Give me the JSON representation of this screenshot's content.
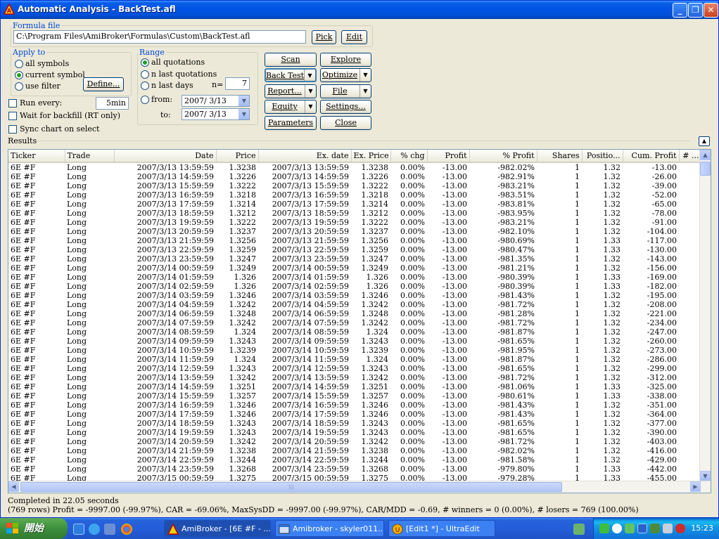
{
  "window": {
    "title": "Automatic Analysis - BackTest.afl"
  },
  "formula": {
    "legend": "Formula file",
    "path": "C:\\Program Files\\AmiBroker\\Formulas\\Custom\\BackTest.afl",
    "pick": "Pick",
    "edit": "Edit"
  },
  "apply_to": {
    "legend": "Apply to",
    "all_symbols": "all symbols",
    "current_symbol": "current symbol",
    "use_filter": "use filter",
    "define": "Define...",
    "selected": "current symbol"
  },
  "range": {
    "legend": "Range",
    "all_quotations": "all quotations",
    "n_last_quotations": "n last quotations",
    "n_last_days": "n last days",
    "n_label": "n=",
    "n_value": "7",
    "from_label": "from:",
    "to_label": "to:",
    "from_date": "2007/  3/13",
    "to_date": "2007/  3/13",
    "selected": "all quotations"
  },
  "options": {
    "run_every": "Run every:",
    "run_every_value": "5min",
    "wait_backfill": "Wait for backfill (RT only)",
    "sync_chart": "Sync chart on select"
  },
  "buttons": {
    "scan": "Scan",
    "explore": "Explore",
    "back_test": "Back Test",
    "optimize": "Optimize",
    "report": "Report...",
    "file": "File",
    "equity": "Equity",
    "settings": "Settings...",
    "parameters": "Parameters",
    "close": "Close"
  },
  "results": {
    "label": "Results",
    "columns": [
      "Ticker",
      "Trade",
      "Date",
      "Price",
      "Ex. date",
      "Ex. Price",
      "% chg",
      "Profit",
      "% Profit",
      "Shares",
      "Positio...",
      "Cum. Profit",
      "# ..."
    ],
    "rows": [
      [
        "6E #F",
        "Long",
        "2007/3/13 13:59:59",
        "1.3238",
        "2007/3/13 13:59:59",
        "1.3238",
        "0.00%",
        "-13.00",
        "-982.02%",
        "1",
        "1.32",
        "-13.00"
      ],
      [
        "6E #F",
        "Long",
        "2007/3/13 14:59:59",
        "1.3226",
        "2007/3/13 14:59:59",
        "1.3226",
        "0.00%",
        "-13.00",
        "-982.91%",
        "1",
        "1.32",
        "-26.00"
      ],
      [
        "6E #F",
        "Long",
        "2007/3/13 15:59:59",
        "1.3222",
        "2007/3/13 15:59:59",
        "1.3222",
        "0.00%",
        "-13.00",
        "-983.21%",
        "1",
        "1.32",
        "-39.00"
      ],
      [
        "6E #F",
        "Long",
        "2007/3/13 16:59:59",
        "1.3218",
        "2007/3/13 16:59:59",
        "1.3218",
        "0.00%",
        "-13.00",
        "-983.51%",
        "1",
        "1.32",
        "-52.00"
      ],
      [
        "6E #F",
        "Long",
        "2007/3/13 17:59:59",
        "1.3214",
        "2007/3/13 17:59:59",
        "1.3214",
        "0.00%",
        "-13.00",
        "-983.81%",
        "1",
        "1.32",
        "-65.00"
      ],
      [
        "6E #F",
        "Long",
        "2007/3/13 18:59:59",
        "1.3212",
        "2007/3/13 18:59:59",
        "1.3212",
        "0.00%",
        "-13.00",
        "-983.95%",
        "1",
        "1.32",
        "-78.00"
      ],
      [
        "6E #F",
        "Long",
        "2007/3/13 19:59:59",
        "1.3222",
        "2007/3/13 19:59:59",
        "1.3222",
        "0.00%",
        "-13.00",
        "-983.21%",
        "1",
        "1.32",
        "-91.00"
      ],
      [
        "6E #F",
        "Long",
        "2007/3/13 20:59:59",
        "1.3237",
        "2007/3/13 20:59:59",
        "1.3237",
        "0.00%",
        "-13.00",
        "-982.10%",
        "1",
        "1.32",
        "-104.00"
      ],
      [
        "6E #F",
        "Long",
        "2007/3/13 21:59:59",
        "1.3256",
        "2007/3/13 21:59:59",
        "1.3256",
        "0.00%",
        "-13.00",
        "-980.69%",
        "1",
        "1.33",
        "-117.00"
      ],
      [
        "6E #F",
        "Long",
        "2007/3/13 22:59:59",
        "1.3259",
        "2007/3/13 22:59:59",
        "1.3259",
        "0.00%",
        "-13.00",
        "-980.47%",
        "1",
        "1.33",
        "-130.00"
      ],
      [
        "6E #F",
        "Long",
        "2007/3/13 23:59:59",
        "1.3247",
        "2007/3/13 23:59:59",
        "1.3247",
        "0.00%",
        "-13.00",
        "-981.35%",
        "1",
        "1.32",
        "-143.00"
      ],
      [
        "6E #F",
        "Long",
        "2007/3/14 00:59:59",
        "1.3249",
        "2007/3/14 00:59:59",
        "1.3249",
        "0.00%",
        "-13.00",
        "-981.21%",
        "1",
        "1.32",
        "-156.00"
      ],
      [
        "6E #F",
        "Long",
        "2007/3/14 01:59:59",
        "1.326",
        "2007/3/14 01:59:59",
        "1.326",
        "0.00%",
        "-13.00",
        "-980.39%",
        "1",
        "1.33",
        "-169.00"
      ],
      [
        "6E #F",
        "Long",
        "2007/3/14 02:59:59",
        "1.326",
        "2007/3/14 02:59:59",
        "1.326",
        "0.00%",
        "-13.00",
        "-980.39%",
        "1",
        "1.33",
        "-182.00"
      ],
      [
        "6E #F",
        "Long",
        "2007/3/14 03:59:59",
        "1.3246",
        "2007/3/14 03:59:59",
        "1.3246",
        "0.00%",
        "-13.00",
        "-981.43%",
        "1",
        "1.32",
        "-195.00"
      ],
      [
        "6E #F",
        "Long",
        "2007/3/14 04:59:59",
        "1.3242",
        "2007/3/14 04:59:59",
        "1.3242",
        "0.00%",
        "-13.00",
        "-981.72%",
        "1",
        "1.32",
        "-208.00"
      ],
      [
        "6E #F",
        "Long",
        "2007/3/14 06:59:59",
        "1.3248",
        "2007/3/14 06:59:59",
        "1.3248",
        "0.00%",
        "-13.00",
        "-981.28%",
        "1",
        "1.32",
        "-221.00"
      ],
      [
        "6E #F",
        "Long",
        "2007/3/14 07:59:59",
        "1.3242",
        "2007/3/14 07:59:59",
        "1.3242",
        "0.00%",
        "-13.00",
        "-981.72%",
        "1",
        "1.32",
        "-234.00"
      ],
      [
        "6E #F",
        "Long",
        "2007/3/14 08:59:59",
        "1.324",
        "2007/3/14 08:59:59",
        "1.324",
        "0.00%",
        "-13.00",
        "-981.87%",
        "1",
        "1.32",
        "-247.00"
      ],
      [
        "6E #F",
        "Long",
        "2007/3/14 09:59:59",
        "1.3243",
        "2007/3/14 09:59:59",
        "1.3243",
        "0.00%",
        "-13.00",
        "-981.65%",
        "1",
        "1.32",
        "-260.00"
      ],
      [
        "6E #F",
        "Long",
        "2007/3/14 10:59:59",
        "1.3239",
        "2007/3/14 10:59:59",
        "1.3239",
        "0.00%",
        "-13.00",
        "-981.95%",
        "1",
        "1.32",
        "-273.00"
      ],
      [
        "6E #F",
        "Long",
        "2007/3/14 11:59:59",
        "1.324",
        "2007/3/14 11:59:59",
        "1.324",
        "0.00%",
        "-13.00",
        "-981.87%",
        "1",
        "1.32",
        "-286.00"
      ],
      [
        "6E #F",
        "Long",
        "2007/3/14 12:59:59",
        "1.3243",
        "2007/3/14 12:59:59",
        "1.3243",
        "0.00%",
        "-13.00",
        "-981.65%",
        "1",
        "1.32",
        "-299.00"
      ],
      [
        "6E #F",
        "Long",
        "2007/3/14 13:59:59",
        "1.3242",
        "2007/3/14 13:59:59",
        "1.3242",
        "0.00%",
        "-13.00",
        "-981.72%",
        "1",
        "1.32",
        "-312.00"
      ],
      [
        "6E #F",
        "Long",
        "2007/3/14 14:59:59",
        "1.3251",
        "2007/3/14 14:59:59",
        "1.3251",
        "0.00%",
        "-13.00",
        "-981.06%",
        "1",
        "1.33",
        "-325.00"
      ],
      [
        "6E #F",
        "Long",
        "2007/3/14 15:59:59",
        "1.3257",
        "2007/3/14 15:59:59",
        "1.3257",
        "0.00%",
        "-13.00",
        "-980.61%",
        "1",
        "1.33",
        "-338.00"
      ],
      [
        "6E #F",
        "Long",
        "2007/3/14 16:59:59",
        "1.3246",
        "2007/3/14 16:59:59",
        "1.3246",
        "0.00%",
        "-13.00",
        "-981.43%",
        "1",
        "1.32",
        "-351.00"
      ],
      [
        "6E #F",
        "Long",
        "2007/3/14 17:59:59",
        "1.3246",
        "2007/3/14 17:59:59",
        "1.3246",
        "0.00%",
        "-13.00",
        "-981.43%",
        "1",
        "1.32",
        "-364.00"
      ],
      [
        "6E #F",
        "Long",
        "2007/3/14 18:59:59",
        "1.3243",
        "2007/3/14 18:59:59",
        "1.3243",
        "0.00%",
        "-13.00",
        "-981.65%",
        "1",
        "1.32",
        "-377.00"
      ],
      [
        "6E #F",
        "Long",
        "2007/3/14 19:59:59",
        "1.3243",
        "2007/3/14 19:59:59",
        "1.3243",
        "0.00%",
        "-13.00",
        "-981.65%",
        "1",
        "1.32",
        "-390.00"
      ],
      [
        "6E #F",
        "Long",
        "2007/3/14 20:59:59",
        "1.3242",
        "2007/3/14 20:59:59",
        "1.3242",
        "0.00%",
        "-13.00",
        "-981.72%",
        "1",
        "1.32",
        "-403.00"
      ],
      [
        "6E #F",
        "Long",
        "2007/3/14 21:59:59",
        "1.3238",
        "2007/3/14 21:59:59",
        "1.3238",
        "0.00%",
        "-13.00",
        "-982.02%",
        "1",
        "1.32",
        "-416.00"
      ],
      [
        "6E #F",
        "Long",
        "2007/3/14 22:59:59",
        "1.3244",
        "2007/3/14 22:59:59",
        "1.3244",
        "0.00%",
        "-13.00",
        "-981.58%",
        "1",
        "1.32",
        "-429.00"
      ],
      [
        "6E #F",
        "Long",
        "2007/3/14 23:59:59",
        "1.3268",
        "2007/3/14 23:59:59",
        "1.3268",
        "0.00%",
        "-13.00",
        "-979.80%",
        "1",
        "1.33",
        "-442.00"
      ],
      [
        "6E #F",
        "Long",
        "2007/3/15 00:59:59",
        "1.3275",
        "2007/3/15 00:59:59",
        "1.3275",
        "0.00%",
        "-13.00",
        "-979.28%",
        "1",
        "1.33",
        "-455.00"
      ]
    ]
  },
  "status": {
    "line1": "Completed in 22.05 seconds",
    "line2": "(769 rows) Profit = -9997.00 (-99.97%), CAR = -69.06%, MaxSysDD = -9997.00 (-99.97%), CAR/MDD = -0.69, # winners = 0 (0.00%), # losers = 769 (100.00%)"
  },
  "taskbar": {
    "start": "開始",
    "tasks": [
      "AmiBroker - [6E #F - ...",
      "Amibroker - skyler011...",
      "[Edit1 *] - UltraEdit"
    ],
    "clock": "15:23"
  }
}
